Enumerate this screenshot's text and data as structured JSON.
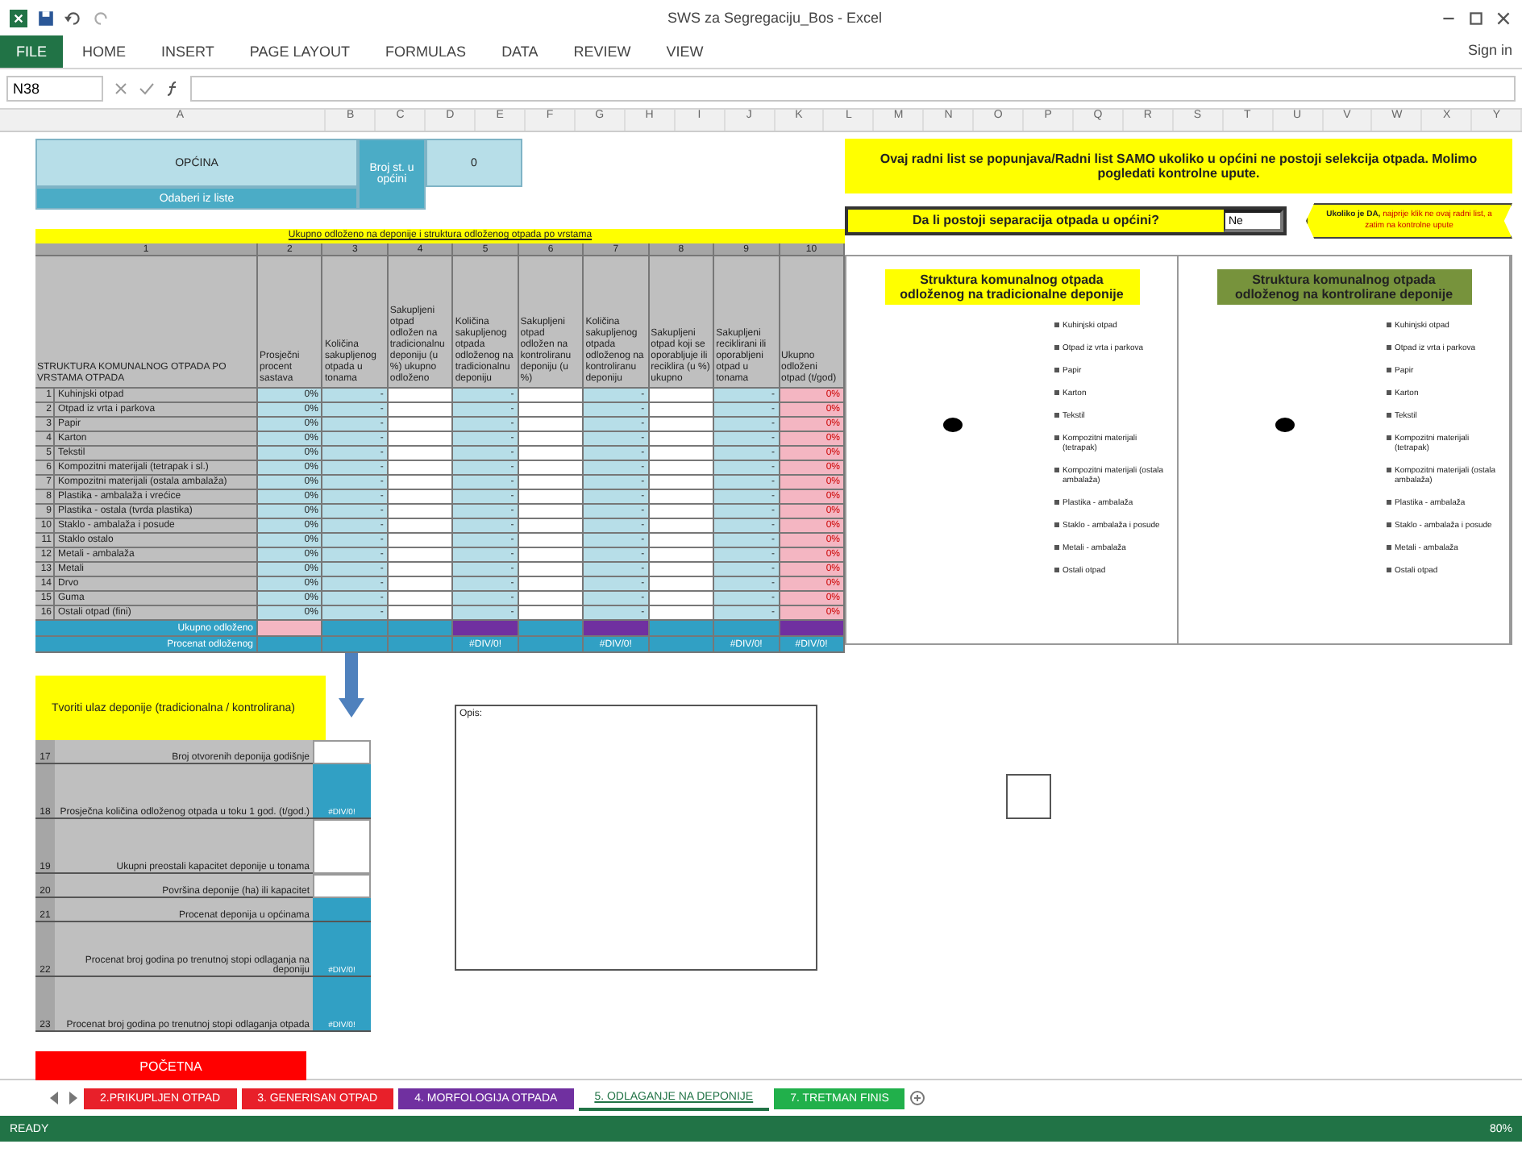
{
  "window": {
    "title": "SWS za Segregaciju_Bos - Excel"
  },
  "ribbon_tabs": [
    {
      "label": "FILE",
      "selected": true
    },
    {
      "label": "HOME",
      "selected": false
    },
    {
      "label": "INSERT",
      "selected": false
    },
    {
      "label": "PAGE LAYOUT",
      "selected": false
    },
    {
      "label": "FORMULAS",
      "selected": false
    },
    {
      "label": "DATA",
      "selected": false
    },
    {
      "label": "REVIEW",
      "selected": false
    },
    {
      "label": "VIEW",
      "selected": false
    }
  ],
  "account": "Sign in",
  "name_box": "N38",
  "column_letters": [
    "A",
    "B",
    "C",
    "D",
    "E",
    "F",
    "G",
    "H",
    "I",
    "J",
    "K",
    "L",
    "M",
    "N",
    "O",
    "P",
    "Q",
    "R",
    "S",
    "T",
    "U",
    "V",
    "W",
    "X",
    "Y"
  ],
  "header": {
    "municipality": "OPĆINA",
    "pick": "Odaberi iz liste",
    "middle": "Broj st. u općini",
    "value": "0"
  },
  "notice": {
    "text": "Ovaj radni list se popunjava/Radni list SAMO ukoliko u općini ne postoji selekcija otpada. Molimo pogledati kontrolne upute."
  },
  "question": {
    "label": "Da li postoji separacija otpada u općini?",
    "answer": "Ne"
  },
  "callout": {
    "lead": "Ukoliko je DA,",
    "text": "najprije klik ne ovaj radni list, a zatim na kontrolne upute"
  },
  "table": {
    "title": "Ukupno odloženo na deponije i struktura odloženog otpada po vrstama",
    "label_number": "1",
    "label": "STRUKTURA KOMUNALNOG OTPADA PO VRSTAMA OTPADA",
    "columns": [
      {
        "number": "2",
        "label": "Prosječni procent sastava",
        "kind": "percent"
      },
      {
        "number": "3",
        "label": "Količina sakupljenog otpada u tonama",
        "kind": "amount"
      },
      {
        "number": "4",
        "label": "Sakupljeni otpad odložen na tradicionalnu deponiju (u %) ukupno odloženo",
        "kind": "input"
      },
      {
        "number": "5",
        "label": "Količina sakupljenog otpada odloženog na tradicionalnu deponiju",
        "kind": "amount"
      },
      {
        "number": "6",
        "label": "Sakupljeni otpad odložen na kontroliranu deponiju (u %)",
        "kind": "input"
      },
      {
        "number": "7",
        "label": "Količina sakupljenog otpada odloženog na kontroliranu deponiju",
        "kind": "amount"
      },
      {
        "number": "8",
        "label": "Sakupljeni otpad koji se oporabljuje ili reciklira (u %) ukupno",
        "kind": "input"
      },
      {
        "number": "9",
        "label": "Sakupljeni reciklirani ili oporabljeni otpad u tonama",
        "kind": "amount"
      },
      {
        "number": "10",
        "label": "Ukupno odloženi otpad (t/god)",
        "kind": "result"
      }
    ],
    "rows": [
      {
        "number": "1",
        "label": "Kuhinjski otpad",
        "cells": [
          "0%",
          "-",
          "",
          "-",
          "",
          "-",
          "",
          "-",
          "0%"
        ]
      },
      {
        "number": "2",
        "label": "Otpad iz vrta i parkova",
        "cells": [
          "0%",
          "-",
          "",
          "-",
          "",
          "-",
          "",
          "-",
          "0%"
        ]
      },
      {
        "number": "3",
        "label": "Papir",
        "cells": [
          "0%",
          "-",
          "",
          "-",
          "",
          "-",
          "",
          "-",
          "0%"
        ]
      },
      {
        "number": "4",
        "label": "Karton",
        "cells": [
          "0%",
          "-",
          "",
          "-",
          "",
          "-",
          "",
          "-",
          "0%"
        ]
      },
      {
        "number": "5",
        "label": "Tekstil",
        "cells": [
          "0%",
          "-",
          "",
          "-",
          "",
          "-",
          "",
          "-",
          "0%"
        ]
      },
      {
        "number": "6",
        "label": "Kompozitni materijali (tetrapak i sl.)",
        "cells": [
          "0%",
          "-",
          "",
          "-",
          "",
          "-",
          "",
          "-",
          "0%"
        ]
      },
      {
        "number": "7",
        "label": "Kompozitni materijali (ostala ambalaža)",
        "cells": [
          "0%",
          "-",
          "",
          "-",
          "",
          "-",
          "",
          "-",
          "0%"
        ]
      },
      {
        "number": "8",
        "label": "Plastika - ambalaža i vrećice",
        "cells": [
          "0%",
          "-",
          "",
          "-",
          "",
          "-",
          "",
          "-",
          "0%"
        ]
      },
      {
        "number": "9",
        "label": "Plastika - ostala (tvrda plastika)",
        "cells": [
          "0%",
          "-",
          "",
          "-",
          "",
          "-",
          "",
          "-",
          "0%"
        ]
      },
      {
        "number": "10",
        "label": "Staklo - ambalaža i posude",
        "cells": [
          "0%",
          "-",
          "",
          "-",
          "",
          "-",
          "",
          "-",
          "0%"
        ]
      },
      {
        "number": "11",
        "label": "Staklo ostalo",
        "cells": [
          "0%",
          "-",
          "",
          "-",
          "",
          "-",
          "",
          "-",
          "0%"
        ]
      },
      {
        "number": "12",
        "label": "Metali - ambalaža",
        "cells": [
          "0%",
          "-",
          "",
          "-",
          "",
          "-",
          "",
          "-",
          "0%"
        ]
      },
      {
        "number": "13",
        "label": "Metali",
        "cells": [
          "0%",
          "-",
          "",
          "-",
          "",
          "-",
          "",
          "-",
          "0%"
        ]
      },
      {
        "number": "14",
        "label": "Drvo",
        "cells": [
          "0%",
          "-",
          "",
          "-",
          "",
          "-",
          "",
          "-",
          "0%"
        ]
      },
      {
        "number": "15",
        "label": "Guma",
        "cells": [
          "0%",
          "-",
          "",
          "-",
          "",
          "-",
          "",
          "-",
          "0%"
        ]
      },
      {
        "number": "16",
        "label": "Ostali otpad (fini)",
        "cells": [
          "0%",
          "-",
          "",
          "-",
          "",
          "-",
          "",
          "-",
          "0%"
        ]
      }
    ],
    "totals": [
      {
        "label": "Ukupno odloženo",
        "cells": [
          {
            "kind": "pink"
          },
          {
            "kind": "teal"
          },
          {
            "kind": "teal"
          },
          {
            "kind": "purple"
          },
          {
            "kind": "teal"
          },
          {
            "kind": "purple"
          },
          {
            "kind": "teal"
          },
          {
            "kind": "teal"
          },
          {
            "kind": "purple"
          }
        ]
      },
      {
        "label": "Procenat odloženog",
        "cells": [
          {
            "kind": "teal"
          },
          {
            "kind": "teal"
          },
          {
            "kind": "teal"
          },
          {
            "kind": "teal",
            "text": "#DIV/0!"
          },
          {
            "kind": "teal"
          },
          {
            "kind": "teal",
            "text": "#DIV/0!"
          },
          {
            "kind": "teal"
          },
          {
            "kind": "teal",
            "text": "#DIV/0!"
          },
          {
            "kind": "teal",
            "text": "#DIV/0!"
          }
        ]
      }
    ]
  },
  "charts": [
    {
      "title": "Struktura komunalnog otpada odloženog na tradicionalne deponije",
      "kind": "yellow",
      "legend": [
        "Kuhinjski otpad",
        "Otpad iz vrta i parkova",
        "Papir",
        "Karton",
        "Tekstil",
        "Kompozitni materijali (tetrapak)",
        "Kompozitni materijali (ostala ambalaža)",
        "Plastika - ambalaža",
        "Staklo - ambalaža i posude",
        "Metali - ambalaža",
        "Ostali otpad"
      ]
    },
    {
      "title": "Struktura komunalnog otpada odloženog na kontrolirane deponije",
      "kind": "green",
      "legend": [
        "Kuhinjski otpad",
        "Otpad iz vrta i parkova",
        "Papir",
        "Karton",
        "Tekstil",
        "Kompozitni materijali (tetrapak)",
        "Kompozitni materijali (ostala ambalaža)",
        "Plastika - ambalaža",
        "Staklo - ambalaža i posude",
        "Metali - ambalaža",
        "Ostali otpad"
      ]
    }
  ],
  "summary": {
    "title": "Tvoriti ulaz deponije (tradicionalna / kontrolirana)",
    "rows": [
      {
        "number": "17",
        "label": "Broj otvorenih deponija godišnje",
        "kind": "input"
      },
      {
        "number": "18",
        "label": "Prosječna količina odloženog otpada u toku 1 god. (t/god.)",
        "kind": "result",
        "value": "#DIV/0!"
      },
      {
        "number": "19",
        "label": "Ukupni preostali kapacitet deponije u tonama",
        "kind": "input"
      },
      {
        "number": "20",
        "label": "Površina deponije (ha) ili kapacitet",
        "kind": "input"
      },
      {
        "number": "21",
        "label": "Procenat deponija u općinama",
        "kind": "result"
      },
      {
        "number": "22",
        "label": "Procenat broj godina po trenutnoj stopi odlaganja na deponiju",
        "kind": "result",
        "value": "#DIV/0!"
      },
      {
        "number": "23",
        "label": "Procenat broj godina po trenutnoj stopi odlaganja otpada",
        "kind": "result",
        "value": "#DIV/0!"
      }
    ]
  },
  "text_box": "Opis:",
  "home_button": "POČETNA",
  "sheet_tabs": [
    {
      "label": "2.PRIKUPLJEN OTPAD",
      "color": "#e8202a",
      "selected": false
    },
    {
      "label": "3. GENERISAN OTPAD",
      "color": "#e8202a",
      "selected": false
    },
    {
      "label": "4. MORFOLOGIJA OTPADA",
      "color": "#7030a0",
      "selected": false
    },
    {
      "label": "5. ODLAGANJE NA DEPONIJE",
      "selected": true
    },
    {
      "label": "7. TRETMAN FINIS",
      "color": "#21b04b",
      "selected": false
    }
  ],
  "status": "READY",
  "zoom": "80%"
}
